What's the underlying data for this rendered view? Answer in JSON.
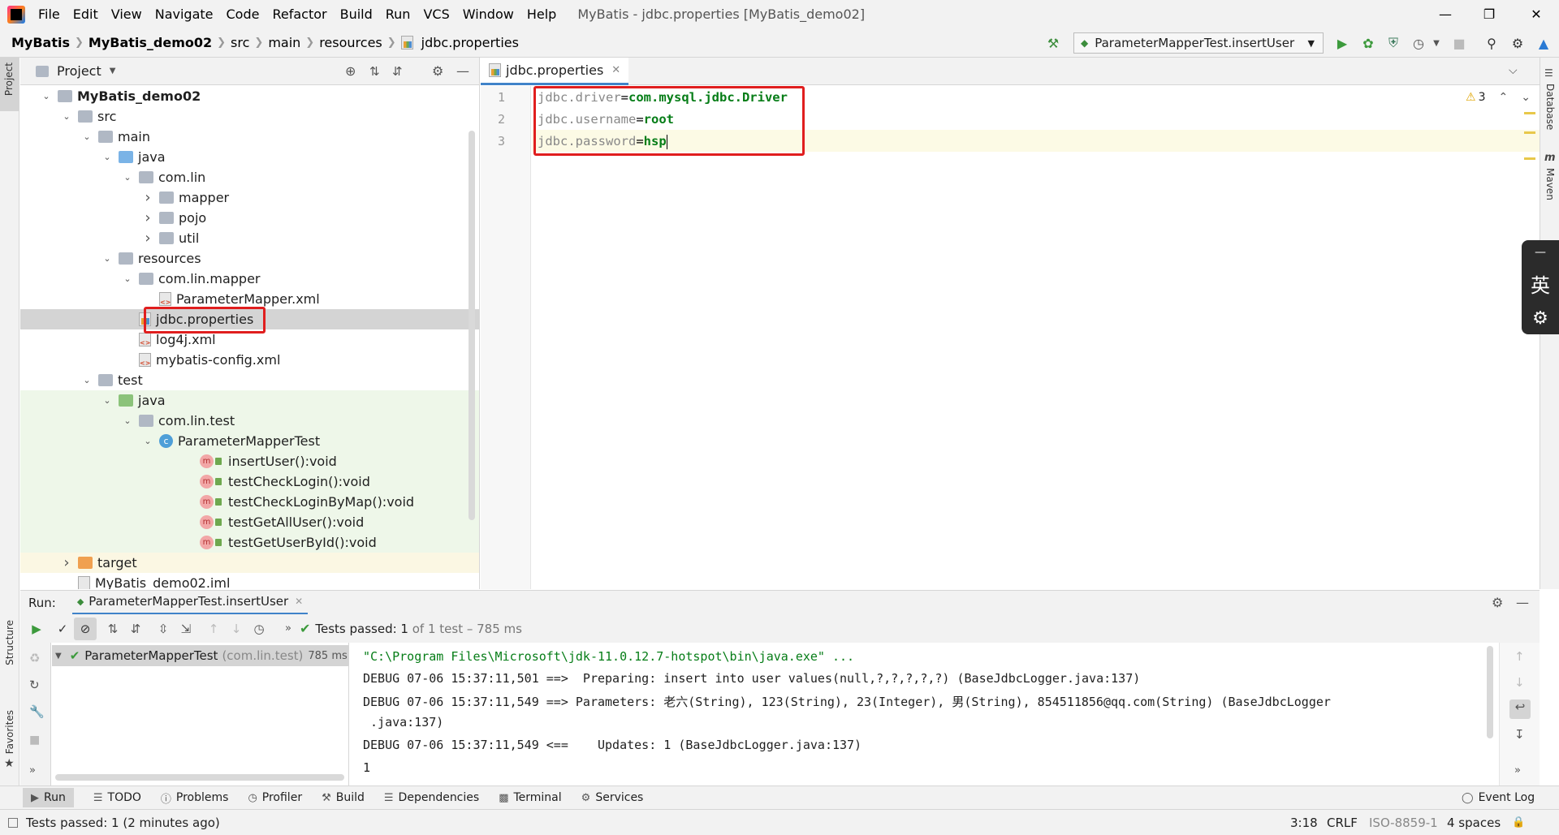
{
  "menubar": {
    "items": [
      "File",
      "Edit",
      "View",
      "Navigate",
      "Code",
      "Refactor",
      "Build",
      "Run",
      "VCS",
      "Window",
      "Help"
    ],
    "title": "MyBatis - jdbc.properties [MyBatis_demo02]"
  },
  "navbar": {
    "breadcrumbs": [
      "MyBatis",
      "MyBatis_demo02",
      "src",
      "main",
      "resources",
      "jdbc.properties"
    ],
    "run_config": "ParameterMapperTest.insertUser"
  },
  "left_stripe": {
    "project": "Project",
    "structure": "Structure",
    "favorites": "Favorites"
  },
  "right_stripe": {
    "database": "Database",
    "maven": "Maven"
  },
  "project_panel": {
    "title": "Project",
    "tree": [
      {
        "label": "MyBatis_demo02",
        "indent": 0,
        "arrow": "down",
        "icon": "module",
        "bold": true
      },
      {
        "label": "src",
        "indent": 1,
        "arrow": "down",
        "icon": "folder"
      },
      {
        "label": "main",
        "indent": 2,
        "arrow": "down",
        "icon": "folder"
      },
      {
        "label": "java",
        "indent": 3,
        "arrow": "down",
        "icon": "src"
      },
      {
        "label": "com.lin",
        "indent": 4,
        "arrow": "down",
        "icon": "pkg"
      },
      {
        "label": "mapper",
        "indent": 5,
        "arrow": "right",
        "icon": "pkg"
      },
      {
        "label": "pojo",
        "indent": 5,
        "arrow": "right",
        "icon": "pkg"
      },
      {
        "label": "util",
        "indent": 5,
        "arrow": "right",
        "icon": "pkg"
      },
      {
        "label": "resources",
        "indent": 3,
        "arrow": "down",
        "icon": "res"
      },
      {
        "label": "com.lin.mapper",
        "indent": 4,
        "arrow": "down",
        "icon": "pkg"
      },
      {
        "label": "ParameterMapper.xml",
        "indent": 5,
        "arrow": "",
        "icon": "xml"
      },
      {
        "label": "jdbc.properties",
        "indent": 4,
        "arrow": "",
        "icon": "props",
        "selected": true
      },
      {
        "label": "log4j.xml",
        "indent": 4,
        "arrow": "",
        "icon": "xml"
      },
      {
        "label": "mybatis-config.xml",
        "indent": 4,
        "arrow": "",
        "icon": "xml"
      },
      {
        "label": "test",
        "indent": 2,
        "arrow": "down",
        "icon": "folder"
      },
      {
        "label": "java",
        "indent": 3,
        "arrow": "down",
        "icon": "testsrc",
        "test": true
      },
      {
        "label": "com.lin.test",
        "indent": 4,
        "arrow": "down",
        "icon": "pkg",
        "test": true
      },
      {
        "label": "ParameterMapperTest",
        "indent": 5,
        "arrow": "down",
        "icon": "class",
        "test": true
      },
      {
        "label": "insertUser():void",
        "indent": 7,
        "arrow": "",
        "icon": "method",
        "test": true
      },
      {
        "label": "testCheckLogin():void",
        "indent": 7,
        "arrow": "",
        "icon": "method",
        "test": true
      },
      {
        "label": "testCheckLoginByMap():void",
        "indent": 7,
        "arrow": "",
        "icon": "method",
        "test": true
      },
      {
        "label": "testGetAllUser():void",
        "indent": 7,
        "arrow": "",
        "icon": "method",
        "test": true
      },
      {
        "label": "testGetUserById():void",
        "indent": 7,
        "arrow": "",
        "icon": "method",
        "test": true
      },
      {
        "label": "target",
        "indent": 1,
        "arrow": "right",
        "icon": "target",
        "yellow": true
      },
      {
        "label": "MyBatis_demo02.iml",
        "indent": 1,
        "arrow": "",
        "icon": "iml"
      }
    ]
  },
  "editor": {
    "tab": "jdbc.properties",
    "warnings": "3",
    "lines": [
      {
        "no": "1",
        "key": "jdbc.driver",
        "value": "com.mysql.jdbc.Driver"
      },
      {
        "no": "2",
        "key": "jdbc.username",
        "value": "root"
      },
      {
        "no": "3",
        "key": "jdbc.password",
        "value": "hsp"
      }
    ]
  },
  "ime": {
    "lang": "英"
  },
  "run_panel": {
    "label": "Run:",
    "tab": "ParameterMapperTest.insertUser",
    "status_prefix": "Tests passed: ",
    "status_count": "1",
    "status_suffix": " of 1 test – 785 ms",
    "test_item": "ParameterMapperTest",
    "test_pkg": "(com.lin.test)",
    "test_time": "785 ms",
    "console": [
      "\"C:\\Program Files\\Microsoft\\jdk-11.0.12.7-hotspot\\bin\\java.exe\" ...",
      "DEBUG 07-06 15:37:11,501 ==>  Preparing: insert into user values(null,?,?,?,?,?) (BaseJdbcLogger.java:137)",
      "DEBUG 07-06 15:37:11,549 ==> Parameters: 老六(String), 123(String), 23(Integer), 男(String), 854511856@qq.com(String) (BaseJdbcLogger",
      " .java:137)",
      "DEBUG 07-06 15:37:11,549 <==    Updates: 1 (BaseJdbcLogger.java:137)",
      "1"
    ]
  },
  "bottom_tools": [
    "Run",
    "TODO",
    "Problems",
    "Profiler",
    "Build",
    "Dependencies",
    "Terminal",
    "Services"
  ],
  "event_log": "Event Log",
  "status": {
    "message": "Tests passed: 1 (2 minutes ago)",
    "position": "3:18",
    "line_sep": "CRLF",
    "encoding": "ISO-8859-1",
    "indent": "4 spaces"
  }
}
